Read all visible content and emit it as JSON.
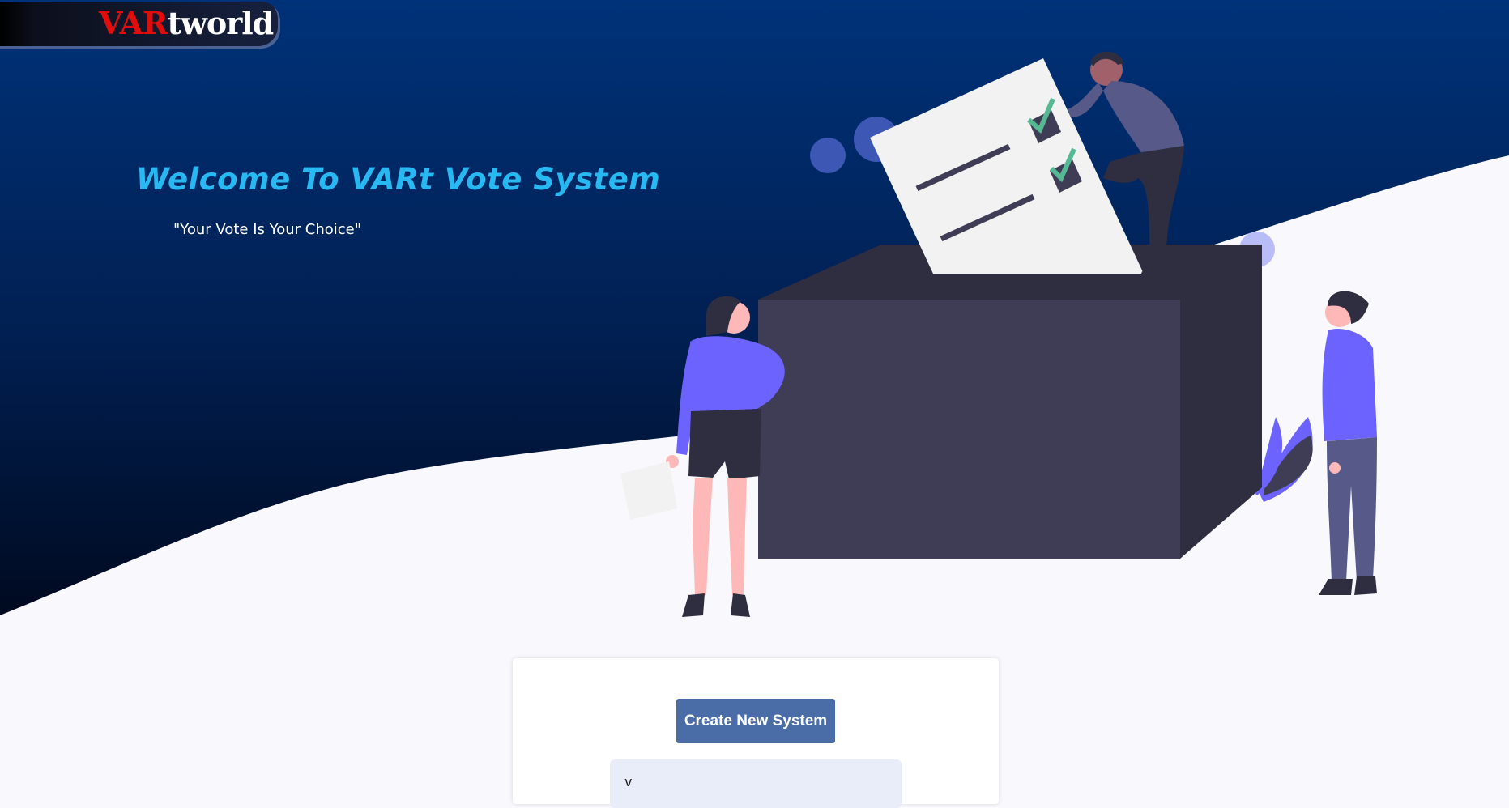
{
  "brand": {
    "accent": "VAR",
    "rest": "tworld"
  },
  "hero": {
    "title": "Welcome To VARt Vote System",
    "slogan": "\"Your Vote Is Your Choice\""
  },
  "actions": {
    "create_label": "Create New System"
  },
  "selector": {
    "text": "v"
  },
  "colors": {
    "hero_top": "#003279",
    "hero_bottom": "#000c24",
    "title": "#29b9f2",
    "button": "#4a6da7",
    "box": "#3f3d56",
    "figure_primary": "#6c63ff"
  },
  "icons": {
    "logo": "brand-logo",
    "illustration": "voting-illustration"
  }
}
